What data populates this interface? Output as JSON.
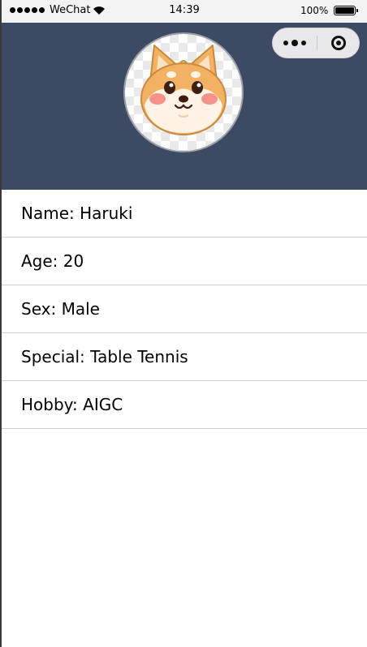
{
  "status_bar": {
    "carrier": "WeChat",
    "time": "14:39",
    "battery": "100%",
    "signal_icon": "signal-dots-icon",
    "wifi_icon": "wifi-icon",
    "battery_icon": "battery-icon",
    "battery_level": 1.0
  },
  "capsule": {
    "more_icon": "more-dots-icon",
    "close_icon": "close-miniprogram-icon"
  },
  "header": {
    "background_color": "#3c4a63",
    "avatar_icon": "shiba-dog-avatar"
  },
  "profile": {
    "rows": [
      {
        "text": "Name: Haruki"
      },
      {
        "text": "Age: 20"
      },
      {
        "text": "Sex: Male"
      },
      {
        "text": "Special: Table Tennis"
      },
      {
        "text": "Hobby: AIGC"
      }
    ]
  }
}
